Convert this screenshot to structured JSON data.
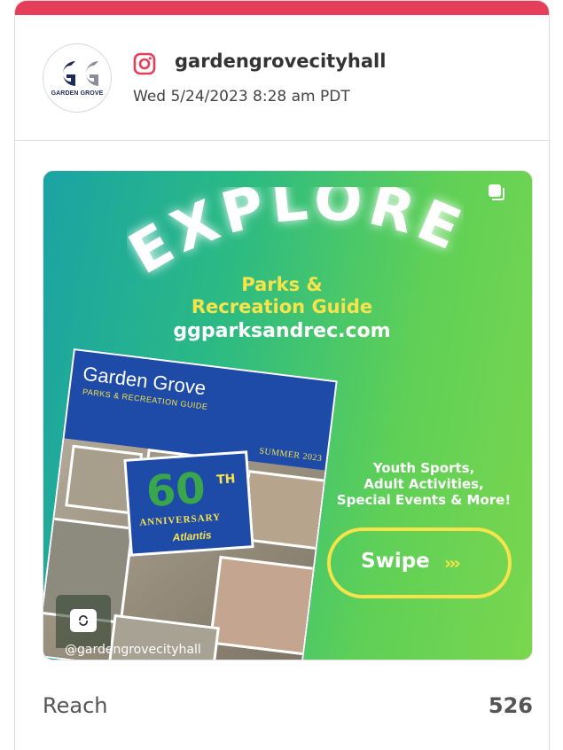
{
  "colors": {
    "accent": "#e53e5a",
    "media_gradient_start": "#1aa3a4",
    "media_gradient_end": "#7ad64e",
    "highlight_yellow": "#f7e34a",
    "guide_blue": "#1e4aa8"
  },
  "post": {
    "network_icon": "instagram-icon",
    "handle": "gardengrovecityhall",
    "timestamp": "Wed 5/24/2023 8:28 am PDT",
    "avatar": {
      "logo_letters": "GG",
      "logo_text": "GARDEN GROVE"
    }
  },
  "media": {
    "carousel_icon": "carousel-icon",
    "reel_icon": "camera-rotate-icon",
    "headline": "EXPLORE",
    "subtitle_line1": "Parks &",
    "subtitle_line2": "Recreation Guide",
    "website": "ggparksandrec.com",
    "guide_title": "Garden Grove",
    "guide_subtitle": "PARKS & RECREATION GUIDE",
    "guide_season": "SUMMER 2023",
    "badge_number": "60",
    "badge_suffix": "TH",
    "badge_word": "ANNIVERSARY",
    "badge_brand": "Atlantis",
    "promo_line1": "Youth Sports,",
    "promo_line2": "Adult Activities,",
    "promo_line3": "Special Events & More!",
    "swipe_label": "Swipe",
    "swipe_arrows": "›››",
    "footer_handle": "@gardengrovecityhall"
  },
  "stats": {
    "label": "Reach",
    "value": "526"
  }
}
